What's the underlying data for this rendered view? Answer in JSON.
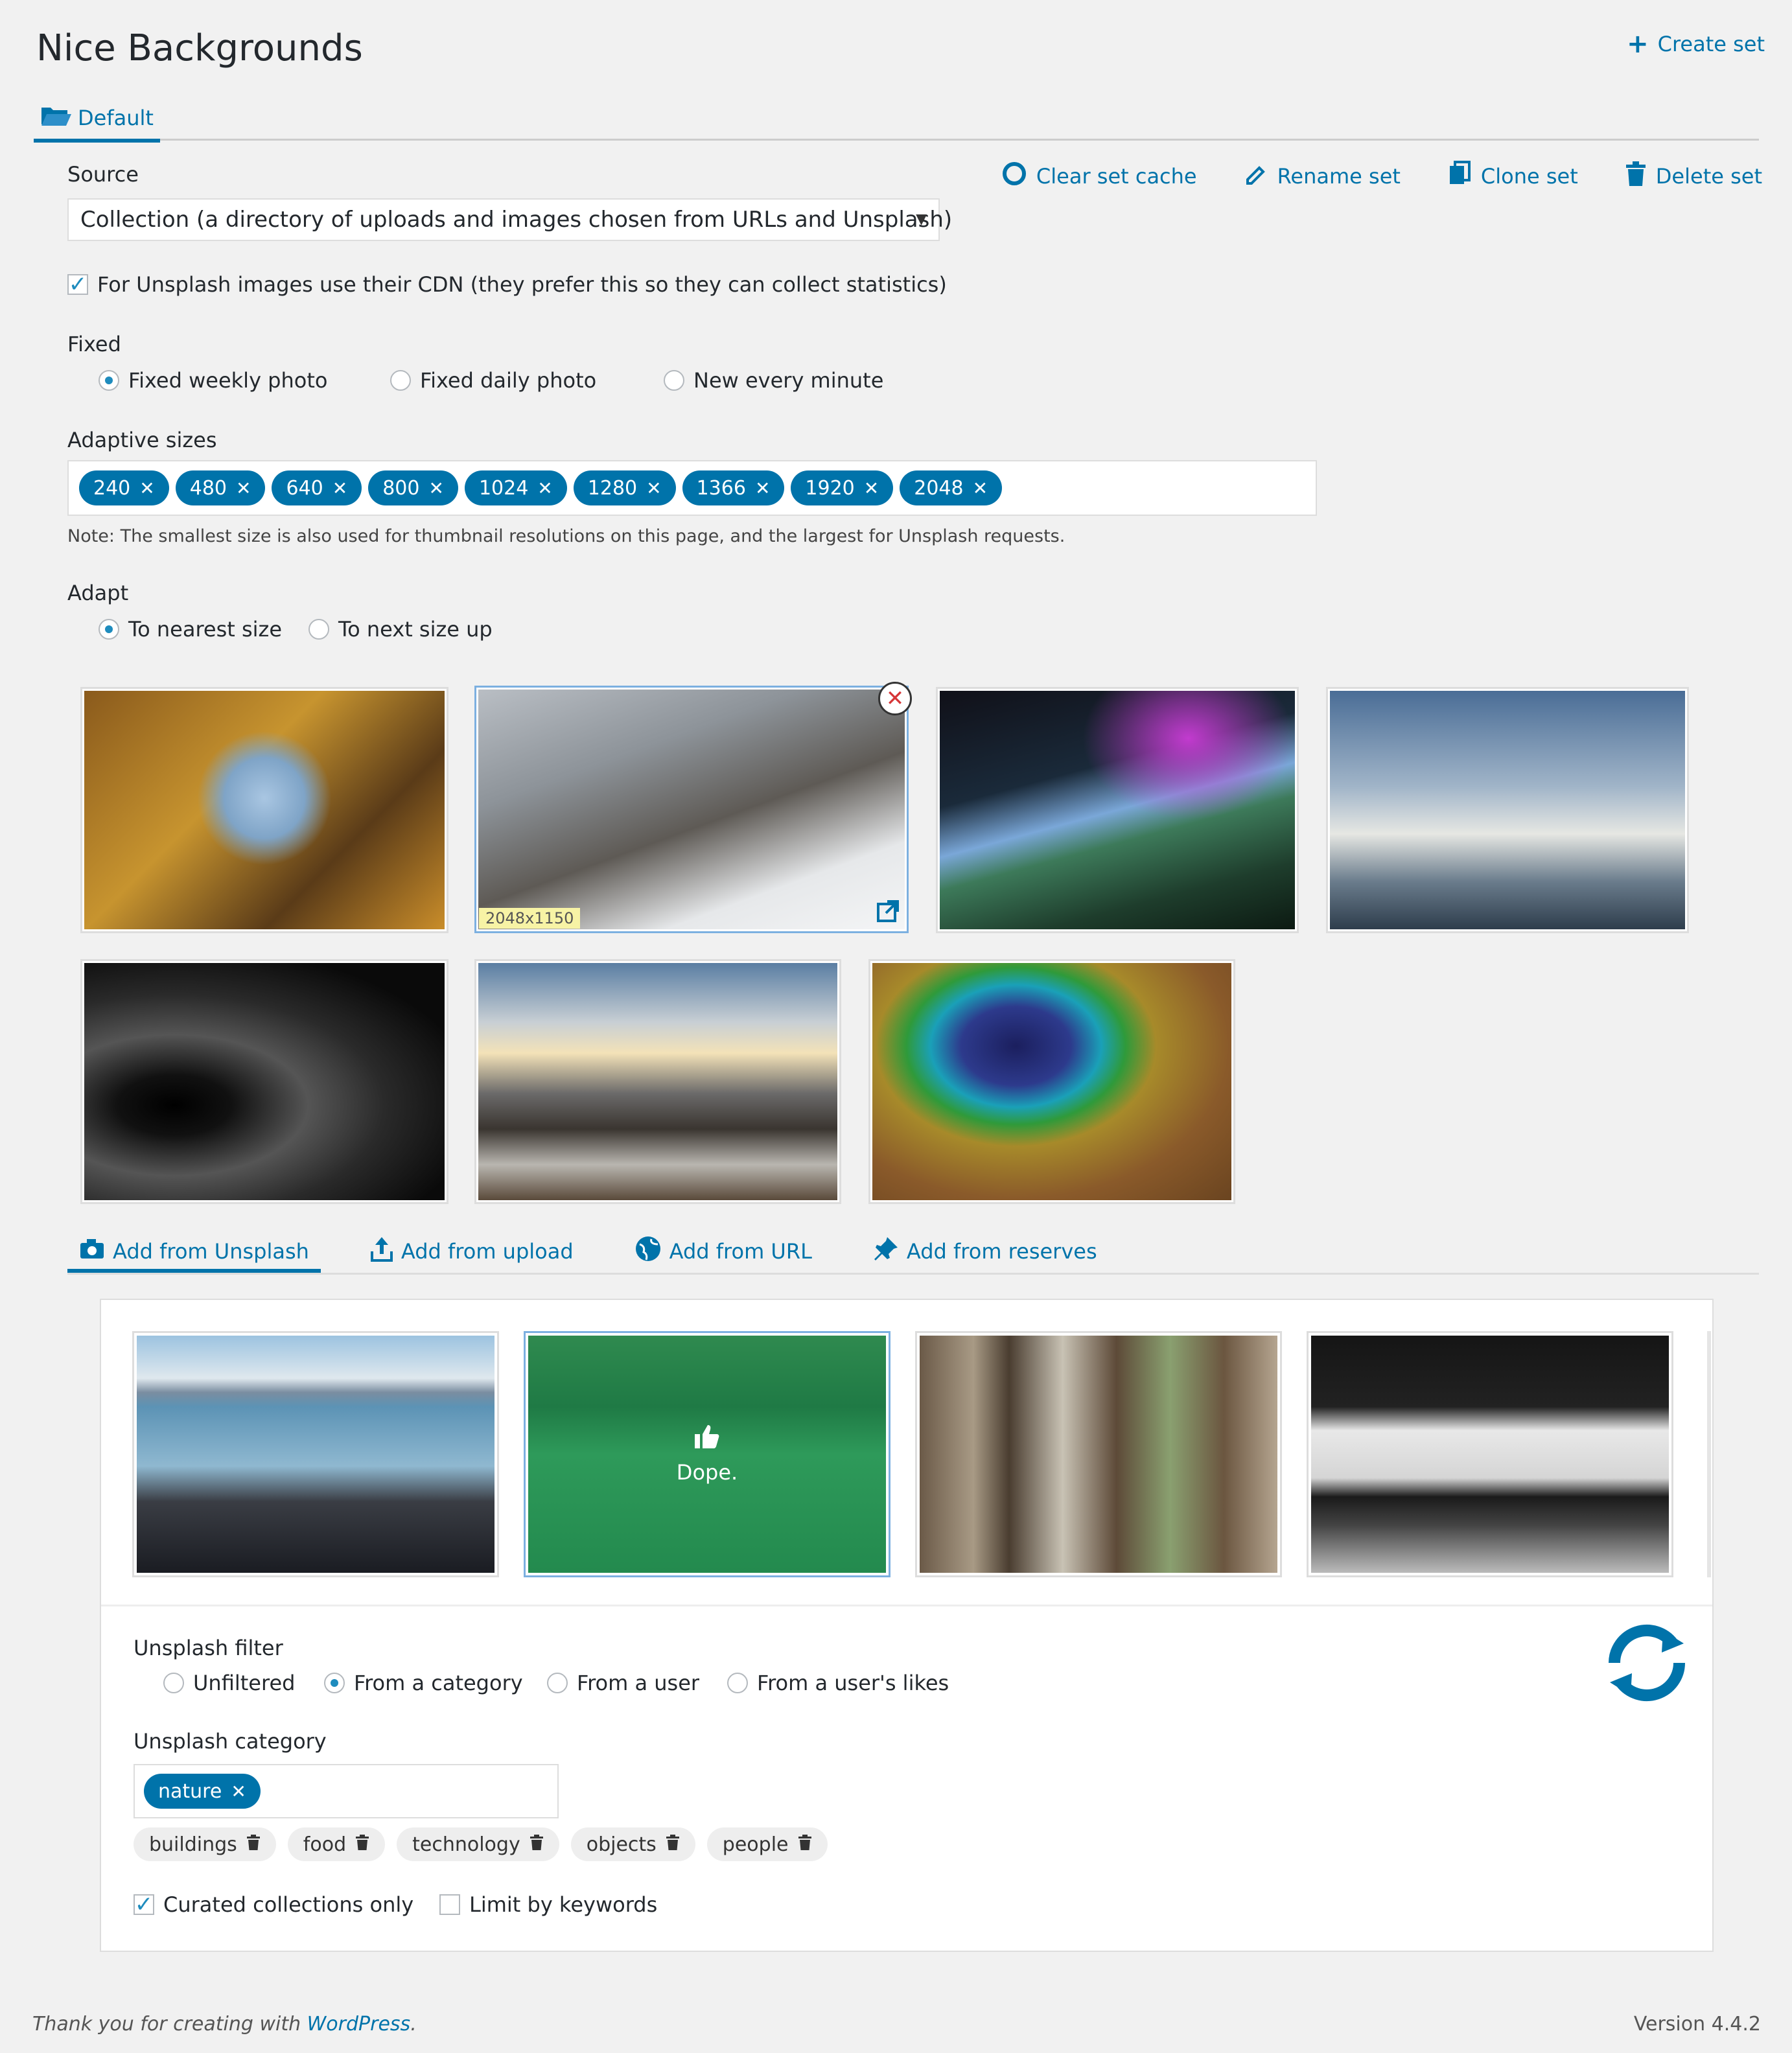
{
  "page": {
    "title": "Nice Backgrounds",
    "create_set": "Create set"
  },
  "tabs": [
    {
      "label": "Default"
    }
  ],
  "actions": {
    "clear": "Clear set cache",
    "rename": "Rename set",
    "clone": "Clone set",
    "delete": "Delete set"
  },
  "source": {
    "label": "Source",
    "value": "Collection (a directory of uploads and images chosen from URLs and Unsplash)"
  },
  "cdn": {
    "label": "For Unsplash images use their CDN (they prefer this so they can collect statistics)",
    "checked": true
  },
  "fixed": {
    "label": "Fixed",
    "options": [
      "Fixed weekly photo",
      "Fixed daily photo",
      "New every minute"
    ],
    "selected": "Fixed weekly photo"
  },
  "adaptive": {
    "label": "Adaptive sizes",
    "sizes": [
      "240",
      "480",
      "640",
      "800",
      "1024",
      "1280",
      "1366",
      "1920",
      "2048"
    ],
    "note": "Note: The smallest size is also used for thumbnail resolutions on this page, and the largest for Unsplash requests."
  },
  "adapt": {
    "label": "Adapt",
    "options": [
      "To nearest size",
      "To next size up"
    ],
    "selected": "To nearest size"
  },
  "gallery": {
    "hover_dimensions": "2048x1150"
  },
  "add_tabs": [
    {
      "label": "Add from Unsplash",
      "icon": "camera-icon"
    },
    {
      "label": "Add from upload",
      "icon": "upload-icon"
    },
    {
      "label": "Add from URL",
      "icon": "globe-icon"
    },
    {
      "label": "Add from reserves",
      "icon": "pin-icon"
    }
  ],
  "unsplash": {
    "hover_text": "Dope.",
    "filter_label": "Unsplash filter",
    "filter_options": [
      "Unfiltered",
      "From a category",
      "From a user",
      "From a user's likes"
    ],
    "filter_selected": "From a category",
    "category_label": "Unsplash category",
    "selected_category": "nature",
    "other_categories": [
      "buildings",
      "food",
      "technology",
      "objects",
      "people"
    ],
    "curated_label": "Curated collections only",
    "curated_checked": true,
    "keywords_label": "Limit by keywords",
    "keywords_checked": false
  },
  "footer": {
    "thanks": "Thank you for creating with ",
    "wp": "WordPress",
    "period": ".",
    "version": "Version 4.4.2"
  },
  "colors": {
    "accent": "#0073aa",
    "background": "#f1f1f1"
  }
}
